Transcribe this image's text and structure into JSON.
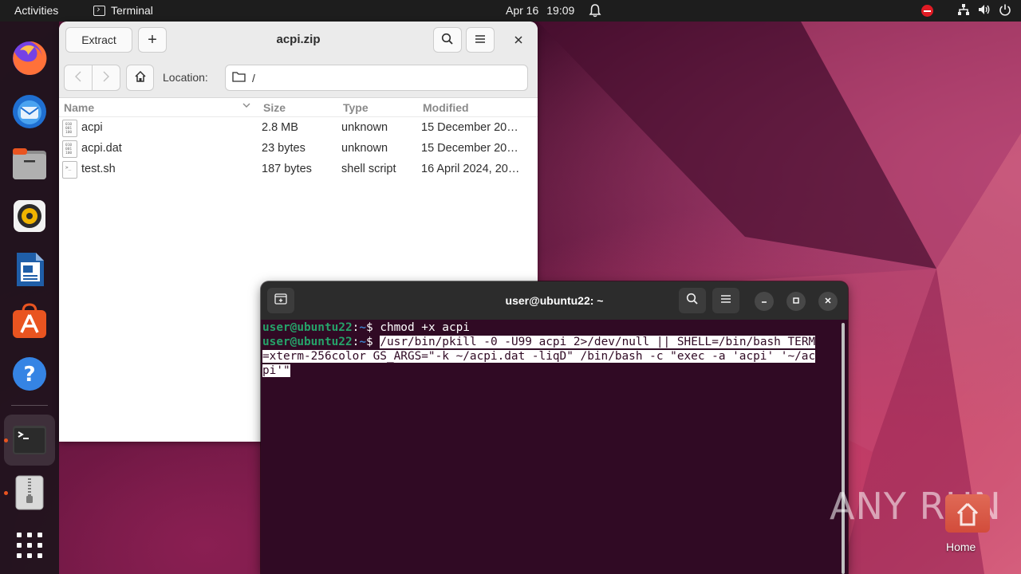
{
  "topbar": {
    "activities": "Activities",
    "app_name": "Terminal",
    "date": "Apr 16",
    "time": "19:09"
  },
  "dock": {
    "items": [
      "firefox-icon",
      "thunderbird-icon",
      "files-icon",
      "rhythmbox-icon",
      "libreoffice-writer-icon",
      "app-center-icon",
      "help-icon",
      "terminal-icon",
      "archive-manager-icon",
      "show-apps-icon"
    ]
  },
  "archive": {
    "extract_label": "Extract",
    "add_label": "+",
    "title": "acpi.zip",
    "location_label": "Location:",
    "location_value": "/",
    "columns": {
      "name": "Name",
      "size": "Size",
      "type": "Type",
      "modified": "Modified"
    },
    "files": [
      {
        "name": "acpi",
        "size": "2.8 MB",
        "type": "unknown",
        "modified": "15 December 20…",
        "icon": "binary"
      },
      {
        "name": "acpi.dat",
        "size": "23 bytes",
        "type": "unknown",
        "modified": "15 December 20…",
        "icon": "binary"
      },
      {
        "name": "test.sh",
        "size": "187 bytes",
        "type": "shell script",
        "modified": "16 April 2024, 20…",
        "icon": "script"
      }
    ]
  },
  "terminal": {
    "title": "user@ubuntu22: ~",
    "prompt_user": "user@ubuntu22",
    "prompt_sep": ":",
    "prompt_path": "~",
    "prompt_dollar": "$",
    "line1_cmd": " chmod +x acpi",
    "line2_cmd_part1": "/usr/bin/pkill -0 -U99 acpi 2>/dev/null || SHELL=/bin/bash TERM",
    "line2_cmd_part2": "=xterm-256color GS_ARGS=\"-k ~/acpi.dat -liqD\" /bin/bash -c \"exec -a 'acpi' '~/ac",
    "line2_cmd_part3": "pi'\""
  },
  "desktop": {
    "watermark": "ANY RUN",
    "home_label": "Home"
  },
  "colors": {
    "accent": "#e95420",
    "terminal_bg": "#300a24",
    "prompt_green": "#26a269",
    "prompt_blue": "#3c80c9"
  }
}
